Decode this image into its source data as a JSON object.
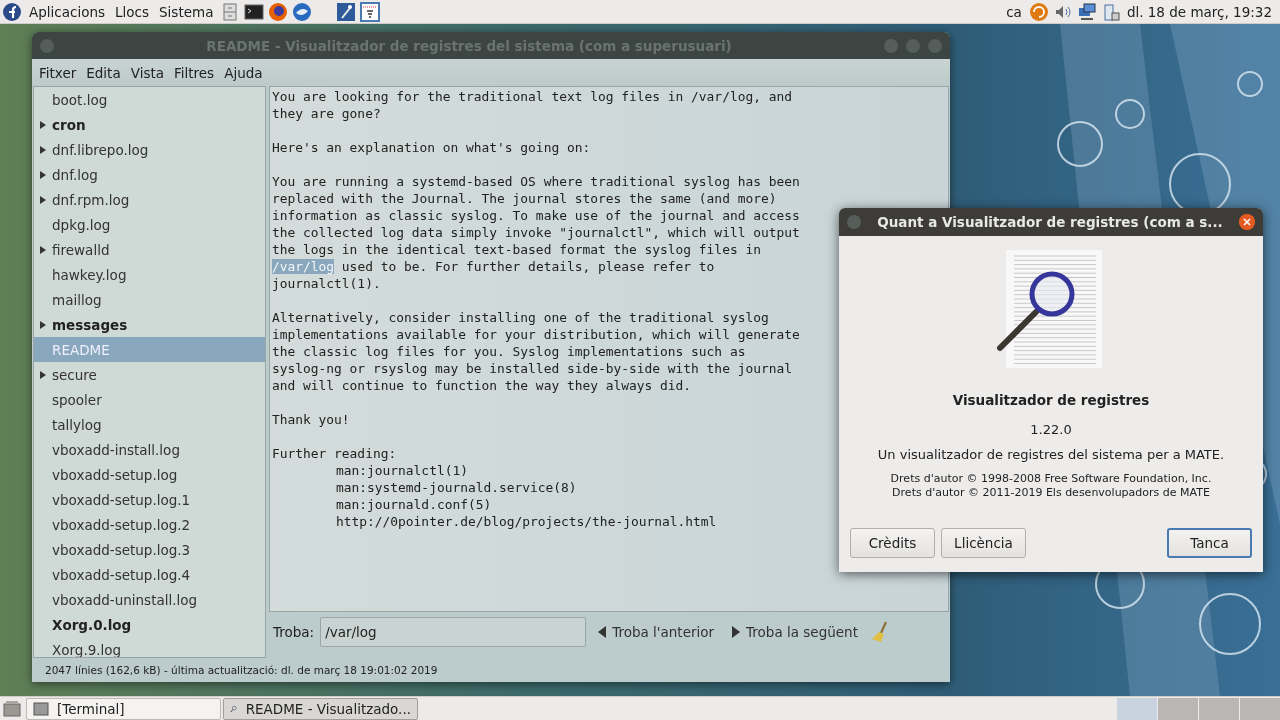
{
  "top_panel": {
    "menus": [
      "Aplicacions",
      "Llocs",
      "Sistema"
    ],
    "keyboard_layout": "ca",
    "clock": "dl. 18 de març, 19:32"
  },
  "main_window": {
    "title": "README - Visualitzador de registres del sistema (com a superusuari)",
    "menu": [
      "Fitxer",
      "Edita",
      "Vista",
      "Filtres",
      "Ajuda"
    ],
    "logs": [
      {
        "label": "boot.log",
        "expandable": false,
        "bold": false,
        "selected": false
      },
      {
        "label": "cron",
        "expandable": true,
        "bold": true,
        "selected": false
      },
      {
        "label": "dnf.librepo.log",
        "expandable": true,
        "bold": false,
        "selected": false
      },
      {
        "label": "dnf.log",
        "expandable": true,
        "bold": false,
        "selected": false
      },
      {
        "label": "dnf.rpm.log",
        "expandable": true,
        "bold": false,
        "selected": false
      },
      {
        "label": "dpkg.log",
        "expandable": false,
        "bold": false,
        "selected": false
      },
      {
        "label": "firewalld",
        "expandable": true,
        "bold": false,
        "selected": false
      },
      {
        "label": "hawkey.log",
        "expandable": false,
        "bold": false,
        "selected": false
      },
      {
        "label": "maillog",
        "expandable": false,
        "bold": false,
        "selected": false
      },
      {
        "label": "messages",
        "expandable": true,
        "bold": true,
        "selected": false
      },
      {
        "label": "README",
        "expandable": false,
        "bold": false,
        "selected": true
      },
      {
        "label": "secure",
        "expandable": true,
        "bold": false,
        "selected": false
      },
      {
        "label": "spooler",
        "expandable": false,
        "bold": false,
        "selected": false
      },
      {
        "label": "tallylog",
        "expandable": false,
        "bold": false,
        "selected": false
      },
      {
        "label": "vboxadd-install.log",
        "expandable": false,
        "bold": false,
        "selected": false
      },
      {
        "label": "vboxadd-setup.log",
        "expandable": false,
        "bold": false,
        "selected": false
      },
      {
        "label": "vboxadd-setup.log.1",
        "expandable": false,
        "bold": false,
        "selected": false
      },
      {
        "label": "vboxadd-setup.log.2",
        "expandable": false,
        "bold": false,
        "selected": false
      },
      {
        "label": "vboxadd-setup.log.3",
        "expandable": false,
        "bold": false,
        "selected": false
      },
      {
        "label": "vboxadd-setup.log.4",
        "expandable": false,
        "bold": false,
        "selected": false
      },
      {
        "label": "vboxadd-uninstall.log",
        "expandable": false,
        "bold": false,
        "selected": false
      },
      {
        "label": "Xorg.0.log",
        "expandable": false,
        "bold": true,
        "selected": false
      },
      {
        "label": "Xorg.9.log",
        "expandable": false,
        "bold": false,
        "selected": false
      }
    ],
    "paragraphs": [
      [
        {
          "kind": "plain",
          "text": "You are looking for the traditional text log files in /var/log, and"
        },
        {
          "kind": "plain",
          "text": "they are gone?"
        }
      ],
      [
        {
          "kind": "plain",
          "text": "Here's an explanation on what's going on:"
        }
      ],
      [
        {
          "kind": "plain",
          "text": "You are running a systemd-based OS where traditional syslog has been"
        },
        {
          "kind": "plain",
          "text": "replaced with the Journal. The journal stores the same (and more)"
        },
        {
          "kind": "plain",
          "text": "information as classic syslog. To make use of the journal and access"
        },
        {
          "kind": "plain",
          "text": "the collected log data simply invoke \"journalctl\", which will output"
        },
        {
          "kind": "plain",
          "text": "the logs in the identical text-based format the syslog files in"
        },
        {
          "kind": "match",
          "match": "/var/log",
          "text": " used to be. For further details, please refer to"
        },
        {
          "kind": "plain",
          "text": "journalctl(1)."
        }
      ],
      [
        {
          "kind": "plain",
          "text": "Alternatively, consider installing one of the traditional syslog"
        },
        {
          "kind": "plain",
          "text": "implementations available for your distribution, which will generate"
        },
        {
          "kind": "plain",
          "text": "the classic log files for you. Syslog implementations such as"
        },
        {
          "kind": "plain",
          "text": "syslog-ng or rsyslog may be installed side-by-side with the journal"
        },
        {
          "kind": "plain",
          "text": "and will continue to function the way they always did."
        }
      ],
      [
        {
          "kind": "plain",
          "text": "Thank you!"
        }
      ],
      [
        {
          "kind": "plain",
          "text": "Further reading:"
        },
        {
          "kind": "indent",
          "text": "man:journalctl(1)"
        },
        {
          "kind": "indent",
          "text": "man:systemd-journald.service(8)"
        },
        {
          "kind": "indent",
          "text": "man:journald.conf(5)"
        },
        {
          "kind": "indent",
          "text": "http://0pointer.de/blog/projects/the-journal.html"
        }
      ]
    ],
    "find": {
      "label": "Troba:",
      "value": "/var/log",
      "previous": "Troba l'anterior",
      "next": "Troba la següent"
    },
    "status_bar": "2047 línies (162,6 kB) - última actualització: dl. de març 18 19:01:02 2019"
  },
  "about_dialog": {
    "title": "Quant a Visualitzador de registres (com a s...",
    "app_name": "Visualitzador de registres",
    "version": "1.22.0",
    "description": "Un visualitzador de registres del sistema per a MATE.",
    "copyright": [
      "Drets d'autor © 1998-2008 Free Software Foundation, Inc.",
      "Drets d'autor © 2011-2019 Els desenvolupadors de MATE"
    ],
    "buttons": [
      {
        "label": "Crèdits",
        "default": false
      },
      {
        "label": "Llicència",
        "default": false
      },
      {
        "label": "Tanca",
        "default": true
      }
    ]
  },
  "taskbar": {
    "tasks": [
      {
        "label": "[Terminal]",
        "selected": false
      },
      {
        "label": "README - Visualitzado...",
        "selected": true
      }
    ]
  }
}
